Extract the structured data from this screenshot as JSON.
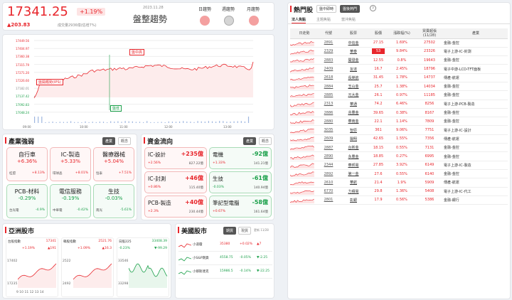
{
  "header": {
    "index": "17341.25",
    "pct": "+1.19%",
    "change": "▲203.83",
    "volume": "成交量2936億(估增7%)",
    "date": "2023.11.28",
    "title": "盤整趨勢",
    "modes": [
      {
        "label": "日趨勢"
      },
      {
        "label": "週趨勢"
      },
      {
        "label": "月趨勢"
      }
    ]
  },
  "intraday": {
    "yticks": [
      "17449.56",
      "17404.97",
      "17360.38",
      "17315.79",
      "17271.20",
      "17226.60",
      "17182.01",
      "17137.42",
      "17092.83",
      "17048.24"
    ],
    "xticks": [
      "09:00",
      "10:00",
      "11:00",
      "12:00",
      "13:00"
    ],
    "label_high": "盤中高",
    "label_open": "盤開趨勢(IPS)",
    "label_low": "盤低"
  },
  "industry": {
    "title": "產業強弱",
    "tabs": [
      "產業",
      "概念"
    ],
    "cells": [
      {
        "name": "自行車",
        "pct": "+6.36%",
        "sub": "桂盟",
        "subpct": "+8.13%"
      },
      {
        "name": "IC-製造",
        "pct": "+5.33%",
        "sub": "環球晶",
        "subpct": "+8.01%"
      },
      {
        "name": "醫療器械",
        "pct": "+5.04%",
        "sub": "恒泰",
        "subpct": "+7.51%"
      },
      {
        "name": "PCB-材料",
        "pct": "-0.29%",
        "sub": "台光電",
        "subpct": "-4.9%"
      },
      {
        "name": "電信服務",
        "pct": "-0.19%",
        "sub": "中華電",
        "subpct": "-0.42%"
      },
      {
        "name": "生技",
        "pct": "-0.03%",
        "sub": "南光",
        "subpct": "-5.61%"
      }
    ]
  },
  "flow": {
    "title": "資金流向",
    "tabs": [
      "產業",
      "概念"
    ],
    "cells": [
      {
        "name": "IC-設計",
        "amt": "+235億",
        "pct": "+2.56%",
        "vol": "827.22億"
      },
      {
        "name": "電機",
        "amt": "-92億",
        "pct": "+1.33%",
        "vol": "141.21億"
      },
      {
        "name": "IC-封測",
        "amt": "+46億",
        "pct": "+0.86%",
        "vol": "115.40億"
      },
      {
        "name": "生技",
        "amt": "-61億",
        "pct": "-0.03%",
        "vol": "140.94億"
      },
      {
        "name": "PCB-製造",
        "amt": "+40億",
        "pct": "+2.3%",
        "vol": "230.44億"
      },
      {
        "name": "筆記型電腦",
        "amt": "-58億",
        "pct": "+0.67%",
        "vol": "161.64億"
      }
    ]
  },
  "asia": {
    "title": "亞洲股市",
    "items": [
      {
        "name": "台股指數",
        "val": "17341",
        "pct": "+1.19%",
        "chg": "▲191"
      },
      {
        "name": "韓股指數",
        "val": "2521.76",
        "pct": "+1.09%",
        "chg": "▲16.3"
      },
      {
        "name": "日股225",
        "val": "33408.39",
        "pct": "-0.23%",
        "chg": "▼-99.29"
      }
    ],
    "axis1": [
      "17402",
      "17235"
    ],
    "axis2": [
      "2522",
      "2492"
    ],
    "axis3": [
      "33546",
      "33298"
    ],
    "dates": "9 10 11 12 13 14"
  },
  "us": {
    "title": "美國股市",
    "tabs": [
      "期貨",
      "現貨"
    ],
    "date": "更新 11/28",
    "items": [
      {
        "name": "小道瓊",
        "val": "35380",
        "pct": "+0.02%",
        "chg": "▲7"
      },
      {
        "name": "小S&P期貨",
        "val": "4558.75",
        "pct": "-0.05%",
        "chg": "▼-2.25"
      },
      {
        "name": "小那斯達克",
        "val": "15986.5",
        "pct": "-0.14%",
        "chg": "▼-22.25"
      }
    ]
  },
  "hot": {
    "title": "熱門股",
    "toptabs": [
      "盤中即時",
      "盤後熱門"
    ],
    "subtabs": [
      "法人焦點",
      "主題焦點",
      "當沖焦點"
    ],
    "columns": [
      "日走勢",
      "代號",
      "股票",
      "股價",
      "漲跌幅(%)",
      "買賣超張\n(11/28)",
      "產業"
    ],
    "rows": [
      {
        "code": "2891",
        "name": "中信金",
        "price": "27.15",
        "pct": "1.69%",
        "vol": "27502",
        "ind": "金融-金控"
      },
      {
        "code": "2329",
        "name": "華泰",
        "price": "53",
        "pct": "9.84%",
        "vol": "23326",
        "ind": "電子上游-IC-封測"
      },
      {
        "code": "2883",
        "name": "開發金",
        "price": "12.55",
        "pct": "0.8%",
        "vol": "19643",
        "ind": "金融-金控"
      },
      {
        "code": "2409",
        "name": "友達",
        "price": "16.7",
        "pct": "2.45%",
        "vol": "18796",
        "ind": "電子中游-LCD-TFT面板"
      },
      {
        "code": "2618",
        "name": "長榮航",
        "price": "31.45",
        "pct": "1.78%",
        "vol": "14737",
        "ind": "傳產-航運"
      },
      {
        "code": "2884",
        "name": "玉山金",
        "price": "25.7",
        "pct": "1.38%",
        "vol": "14034",
        "ind": "金融-金控"
      },
      {
        "code": "2885",
        "name": "元大金",
        "price": "26.1",
        "pct": "0.97%",
        "vol": "11185",
        "ind": "金融-金控"
      },
      {
        "code": "2313",
        "name": "華通",
        "price": "74.2",
        "pct": "6.46%",
        "vol": "8256",
        "ind": "電子上游-PCB-製造"
      },
      {
        "code": "2886",
        "name": "兆豐金",
        "price": "39.65",
        "pct": "0.38%",
        "vol": "8167",
        "ind": "金融-金控"
      },
      {
        "code": "2880",
        "name": "華南金",
        "price": "22.1",
        "pct": "1.14%",
        "vol": "7809",
        "ind": "金融-金控"
      },
      {
        "code": "3035",
        "name": "智原",
        "price": "361",
        "pct": "9.06%",
        "vol": "7751",
        "ind": "電子上游-IC-設計"
      },
      {
        "code": "2609",
        "name": "陽明",
        "price": "42.65",
        "pct": "1.55%",
        "vol": "7356",
        "ind": "傳產-航運"
      },
      {
        "code": "2887",
        "name": "台新金",
        "price": "18.15",
        "pct": "0.55%",
        "vol": "7131",
        "ind": "金融-金控"
      },
      {
        "code": "2890",
        "name": "永豐金",
        "price": "18.85",
        "pct": "0.27%",
        "vol": "6995",
        "ind": "金融-金控"
      },
      {
        "code": "2344",
        "name": "華邦電",
        "price": "27.85",
        "pct": "3.92%",
        "vol": "6149",
        "ind": "電子上游-IC-製造"
      },
      {
        "code": "2892",
        "name": "第一金",
        "price": "27.6",
        "pct": "0.55%",
        "vol": "6140",
        "ind": "金融-金控"
      },
      {
        "code": "2610",
        "name": "華航",
        "price": "21.4",
        "pct": "1.9%",
        "vol": "5909",
        "ind": "傳產-航運"
      },
      {
        "code": "6770",
        "name": "力積電",
        "price": "29.8",
        "pct": "1.36%",
        "vol": "5408",
        "ind": "電子上游-IC-代工"
      },
      {
        "code": "2801",
        "name": "彰銀",
        "price": "17.9",
        "pct": "0.56%",
        "vol": "5386",
        "ind": "金融-銀行"
      }
    ]
  },
  "colors": {
    "up": "#e8262c",
    "down": "#1ba04a"
  }
}
